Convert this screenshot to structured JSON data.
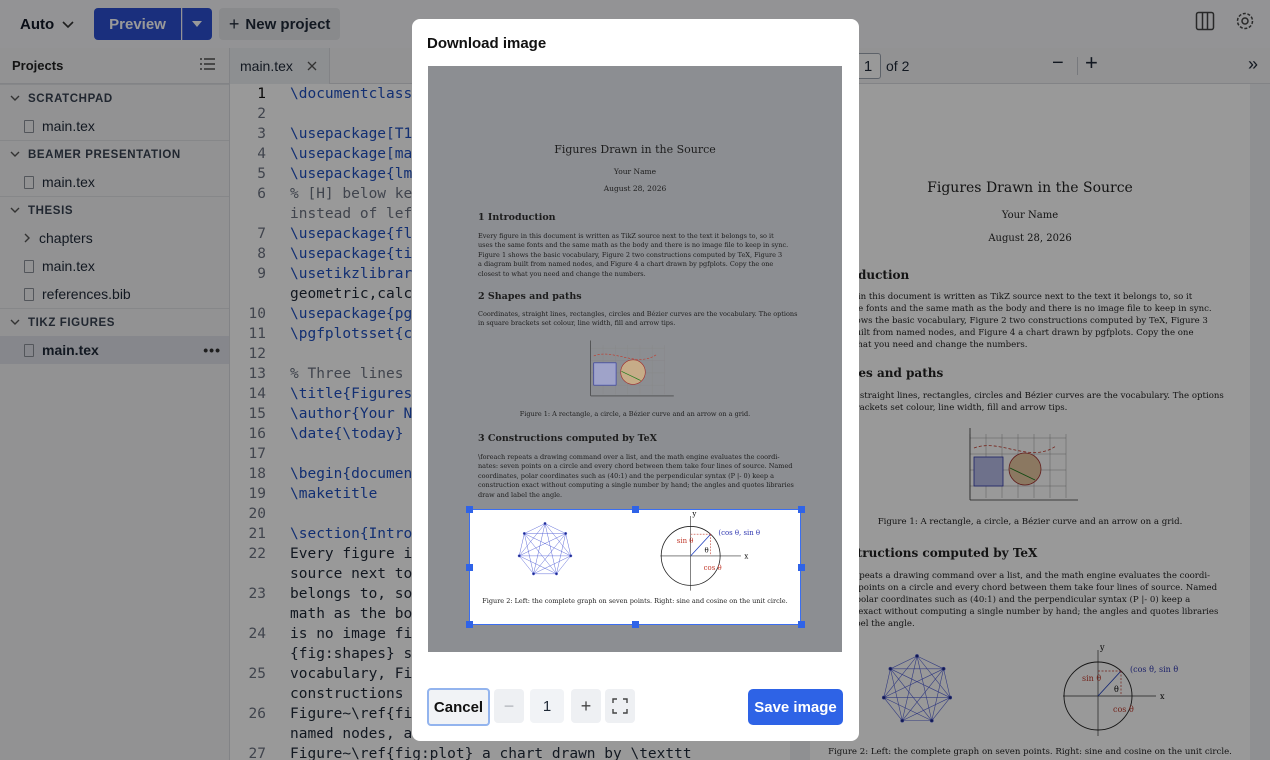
{
  "topbar": {
    "auto_label": "Auto",
    "preview_label": "Preview",
    "new_project_label": "New project"
  },
  "sidebar": {
    "title": "Projects",
    "sections": [
      {
        "name": "SCRATCHPAD",
        "files": [
          "main.tex"
        ]
      },
      {
        "name": "BEAMER PRESENTATION",
        "files": [
          "main.tex"
        ]
      },
      {
        "name": "THESIS",
        "folder": "chapters",
        "files": [
          "main.tex",
          "references.bib"
        ]
      },
      {
        "name": "TIKZ FIGURES",
        "files": [
          "main.tex"
        ]
      }
    ],
    "active_more": "•••"
  },
  "editor": {
    "tab_label": "main.tex",
    "line_numbers": [
      "1",
      "2",
      "3",
      "4",
      "5",
      "6",
      "7",
      "8",
      "9",
      "10",
      "11",
      "12",
      "13",
      "14",
      "15",
      "16",
      "17",
      "18",
      "19",
      "20",
      "21",
      "22",
      "23",
      "24",
      "25",
      "26",
      "27"
    ],
    "lines": {
      "l1": "documentclass[",
      "l3": "usepackage[T1]",
      "l4": "usepackage[mar",
      "l5": "usepackage{lmo",
      "l6a": "% [H] below kee",
      "l6b": "instead of lef",
      "l7": "usepackage{flo",
      "l8": "usepackage{tik",
      "l9a": "usetikzlibrary",
      "l9b": "geometric,calc,",
      "l10": "usepackage{pgf",
      "l11": "pgfplotsset{co",
      "l13": "% Three lines t",
      "l14": "title{Figures",
      "l15": "author{Your Na",
      "l16": "date{\\today}",
      "l18": "begin{document",
      "l19": "maketitle",
      "l21": "section{Introd",
      "l22a": "Every figure in",
      "l22b": "source next to",
      "l23a": "belongs to, so",
      "l23b": "math as the boo",
      "l24a": "is no image fil",
      "l24b": "{fig:shapes} sh",
      "l25a": "vocabulary, Fig",
      "l25b": "constructions c",
      "l26a": "Figure~\\ref{fig",
      "l26b": "named nodes, an",
      "l27": "Figure~\\ref{fig:plot} a chart drawn by \\texttt"
    }
  },
  "pdf": {
    "page": "1",
    "of_label": "of 2",
    "title": "Figures Drawn in the Source",
    "author": "Your Name",
    "date": "August 28, 2026",
    "h_intro": "oduction",
    "intro_lines": [
      "e in this document is written as TikZ source next to the text it belongs to, so it",
      "me fonts and the same math as the body and there is no image file to keep in sync.",
      "hows the basic vocabulary, Figure 2 two constructions computed by TeX, Figure 3",
      "built from named nodes, and Figure 4 a chart drawn by pgfplots.  Copy the one",
      "what you need and change the numbers."
    ],
    "h_shapes": "pes and paths",
    "shapes_lines": [
      "s, straight lines, rectangles, circles and Bézier curves are the vocabulary.  The options",
      "brackets set colour, line width, fill and arrow tips."
    ],
    "fig1_caption": "Figure 1:  A rectangle, a circle, a Bézier curve and an arrow on a grid.",
    "h_constr": "structions computed by TeX",
    "constr_lines": [
      "repeats a drawing command over a list, and the math engine evaluates the coordi-",
      "n points on a circle and every chord between them take four lines of source.  Named",
      ", polar coordinates such as (40:1) and the perpendicular syntax (P |- 0) keep a",
      "n exact without computing a single number by hand; the angles and quotes libraries",
      "abel the angle."
    ],
    "fig2_caption": "Figure 2:  Left:  the complete graph on seven points.  Right:  sine and cosine on the unit circle."
  },
  "modal": {
    "title": "Download image",
    "cancel_label": "Cancel",
    "scale_value": "1",
    "save_label": "Save image",
    "page": {
      "title": "Figures Drawn in the Source",
      "author": "Your Name",
      "date": "August 28, 2026",
      "h1": "1   Introduction",
      "intro": [
        "Every figure in this document is written as TikZ source next to the text it belongs to, so it",
        "uses the same fonts and the same math as the body and there is no image file to keep in sync.",
        "Figure 1 shows the basic vocabulary, Figure 2 two constructions computed by TeX, Figure 3",
        "a diagram built from named nodes, and Figure 4 a chart drawn by pgfplots.  Copy the one",
        "closest to what you need and change the numbers."
      ],
      "h2": "2   Shapes and paths",
      "shapes": [
        "Coordinates, straight lines, rectangles, circles and Bézier curves are the vocabulary.  The options",
        "in square brackets set colour, line width, fill and arrow tips."
      ],
      "fig1_caption": "Figure 1:  A rectangle, a circle, a Bézier curve and an arrow on a grid.",
      "h3": "3   Constructions computed by TeX",
      "constr": [
        "\\foreach repeats a drawing command over a list, and the math engine evaluates the coordi-",
        "nates: seven points on a circle and every chord between them take four lines of source.  Named",
        "coordinates, polar coordinates such as (40:1) and the perpendicular syntax (P |- 0) keep a",
        "construction exact without computing a single number by hand; the angles and quotes libraries",
        "draw and label the angle."
      ],
      "fig2_caption": "Figure 2:  Left:  the complete graph on seven points.  Right:  sine and cosine on the unit circle."
    }
  },
  "figure_labels": {
    "x": "x",
    "y": "y",
    "cossin": "(cos θ, sin θ)",
    "sin": "sin θ",
    "cos": "cos θ",
    "theta": "θ"
  }
}
